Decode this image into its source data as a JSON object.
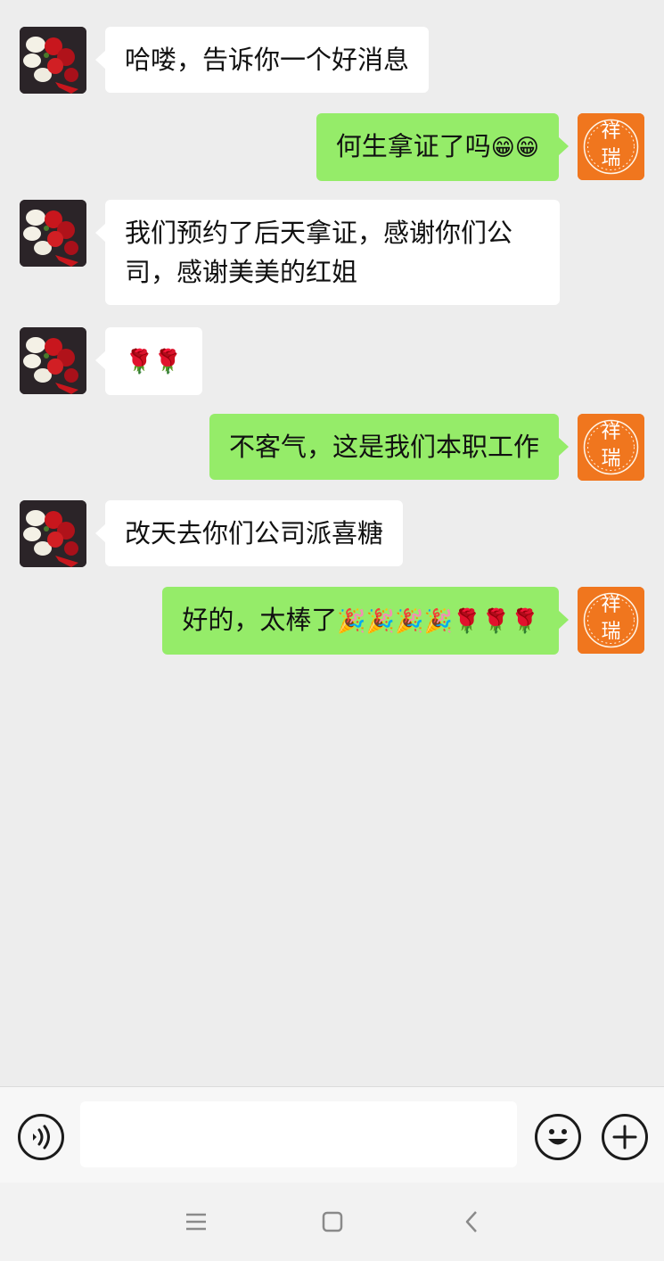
{
  "messages": [
    {
      "side": "left",
      "text": "哈喽，告诉你一个好消息"
    },
    {
      "side": "right",
      "text": "何生拿证了吗",
      "emoji": "😁😁"
    },
    {
      "side": "left",
      "text": "我们预约了后天拿证，感谢你们公司，感谢美美的红姐"
    },
    {
      "side": "left",
      "text": "",
      "emoji": "🌹🌹"
    },
    {
      "side": "right",
      "text": "不客气，这是我们本职工作"
    },
    {
      "side": "left",
      "text": "改天去你们公司派喜糖"
    },
    {
      "side": "right",
      "text": "好的，太棒了",
      "emoji": "🎉🎉🎉🎉🌹🌹🌹"
    }
  ],
  "self_avatar": {
    "line1": "祥",
    "line2": "瑞",
    "color": "#f0761e"
  },
  "colors": {
    "self_bubble": "#95ec69",
    "other_bubble": "#ffffff",
    "background": "#ededed"
  },
  "icons": {
    "voice": "voice-icon",
    "emoji": "emoji-icon",
    "plus": "plus-icon",
    "menu": "menu-icon",
    "home": "home-icon",
    "back": "back-icon"
  }
}
